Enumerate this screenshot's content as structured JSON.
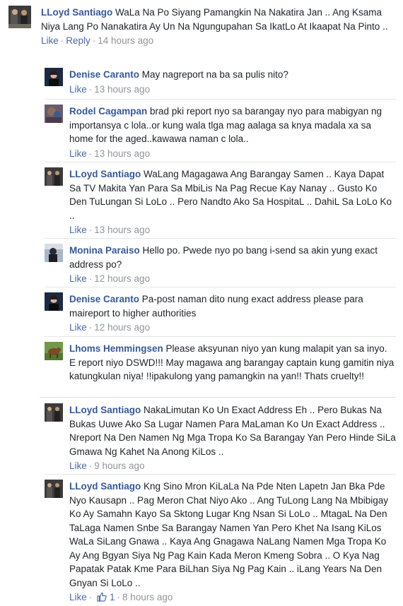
{
  "comments": [
    {
      "name": "LLoyd Santiago",
      "text": "WaLa Na Po Siyang Pamangkin Na Nakatira Jan .. Ang Ksama Niya Lang Po Nanakatira Ay Un Na Ngungupahan Sa IkatLo At Ikaapat Na Pinto ..",
      "like": "Like",
      "reply": "Reply",
      "time": "14 hours ago"
    },
    {
      "name": "Denise Caranto",
      "text": "May nagreport na ba sa pulis nito?",
      "like": "Like",
      "time": "13 hours ago"
    },
    {
      "name": "Rodel Cagampan",
      "text": "brad pki report nyo sa barangay nyo para mabigyan ng importansya c lola..or kung wala tlga mag aalaga sa knya madala xa sa home for the aged..kawawa naman c lola..",
      "like": "Like",
      "time": "13 hours ago"
    },
    {
      "name": "LLoyd Santiago",
      "text": "WaLang Magagawa Ang Barangay Samen .. Kaya Dapat Sa TV Makita Yan Para Sa MbiLis Na Pag Recue Kay Nanay .. Gusto Ko Den TuLungan Si LoLo .. Pero Nandto Ako Sa HospitaL .. DahiL Sa LoLo Ko ..",
      "like": "Like",
      "time": "13 hours ago"
    },
    {
      "name": "Monina Paraiso",
      "text": "Hello po. Pwede nyo po bang i-send sa akin yung exact address po?",
      "like": "Like",
      "time": "12 hours ago"
    },
    {
      "name": "Denise Caranto",
      "text": "Pa-post naman dito nung exact address please para maireport to higher authorities",
      "like": "Like",
      "time": "12 hours ago"
    },
    {
      "name": "Lhoms Hemmingsen",
      "text": "Please aksyunan niyo yan kung malapit yan sa inyo. E report niyo DSWD!!! May magawa ang barangay captain kung gamitin niya katungkulan niya! !!ipakulong yang pamangkin na yan!! Thats cruelty!!"
    },
    {
      "name": "LLoyd Santiago",
      "text": "NakaLimutan Ko Un Exact Address Eh .. Pero Bukas Na Bukas Uuwe Ako Sa Lugar Namen Para MaLaman Ko Un Exact Address .. Nreport Na Den Namen Ng Mga Tropa Ko Sa Barangay Yan Pero Hinde SiLa Gmawa Ng Kahet Na Anong KiLos ..",
      "like": "Like",
      "time": "9 hours ago"
    },
    {
      "name": "LLoyd Santiago",
      "text": "Kng Sino Mron KiLaLa Na Pde Nten Lapetn Jan Bka Pde Nyo Kausapn .. Pag Meron Chat Niyo Ako .. Ang TuLong Lang Na Mbibigay Ko Ay Samahn Kayo Sa Sktong Lugar Kng Nsan Si LoLo .. MtagaL Na Den TaLaga Namen Snbe Sa Barangay Namen Yan Pero Khet Na Isang KiLos WaLa SiLang Gnawa .. Kaya Ang Gnagawa NaLang Namen Mga Tropa Ko Ay Ang Bgyan Siya Ng Pag Kain Kada Meron Kmeng Sobra .. O Kya Nag Papatak Patak Kme Para BiLhan Siya Ng Pag Kain .. iLang Years Na Den Gnyan Si LoLo ..",
      "like": "Like",
      "like_count": "1",
      "time": "8 hours ago"
    }
  ],
  "colors": {
    "name": "#365899",
    "meta": "#90949c",
    "link": "#4b6aab"
  },
  "icons": [
    "thumbs-up-icon"
  ]
}
